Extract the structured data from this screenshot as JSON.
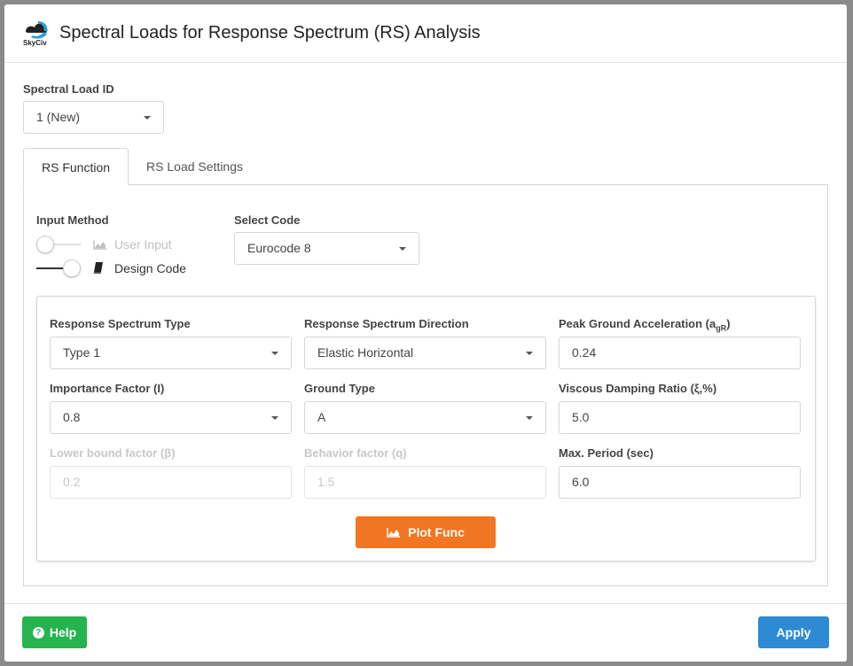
{
  "header": {
    "logo_text": "SkyCiv",
    "title": "Spectral Loads for Response Spectrum (RS) Analysis"
  },
  "spectral_load": {
    "label": "Spectral Load ID",
    "value": "1 (New)"
  },
  "tabs": [
    {
      "label": "RS Function",
      "active": true
    },
    {
      "label": "RS Load Settings",
      "active": false
    }
  ],
  "input_method": {
    "label": "Input Method",
    "options": [
      {
        "label": "User Input",
        "icon": "area-chart-icon",
        "on": false
      },
      {
        "label": "Design Code",
        "icon": "book-icon",
        "on": true
      }
    ]
  },
  "select_code": {
    "label": "Select Code",
    "value": "Eurocode 8"
  },
  "fields": {
    "rs_type": {
      "label": "Response Spectrum Type",
      "value": "Type 1"
    },
    "rs_direction": {
      "label": "Response Spectrum Direction",
      "value": "Elastic Horizontal"
    },
    "pga": {
      "label": "Peak Ground Acceleration (a",
      "sub": "gR",
      "label_end": ")",
      "value": "0.24"
    },
    "importance": {
      "label": "Importance Factor (I)",
      "value": "0.8"
    },
    "ground_type": {
      "label": "Ground Type",
      "value": "A"
    },
    "damping": {
      "label": "Viscous Damping Ratio (ξ,%)",
      "value": "5.0"
    },
    "lower_bound": {
      "label": "Lower bound factor (β)",
      "value": "0.2"
    },
    "behavior": {
      "label": "Behavior factor (q)",
      "value": "1.5"
    },
    "max_period": {
      "label": "Max. Period (sec)",
      "value": "6.0"
    }
  },
  "buttons": {
    "plot": "Plot Func",
    "help": "Help",
    "apply": "Apply"
  },
  "colors": {
    "plot": "#f07623",
    "help": "#26b44f",
    "apply": "#2d8bd5"
  }
}
